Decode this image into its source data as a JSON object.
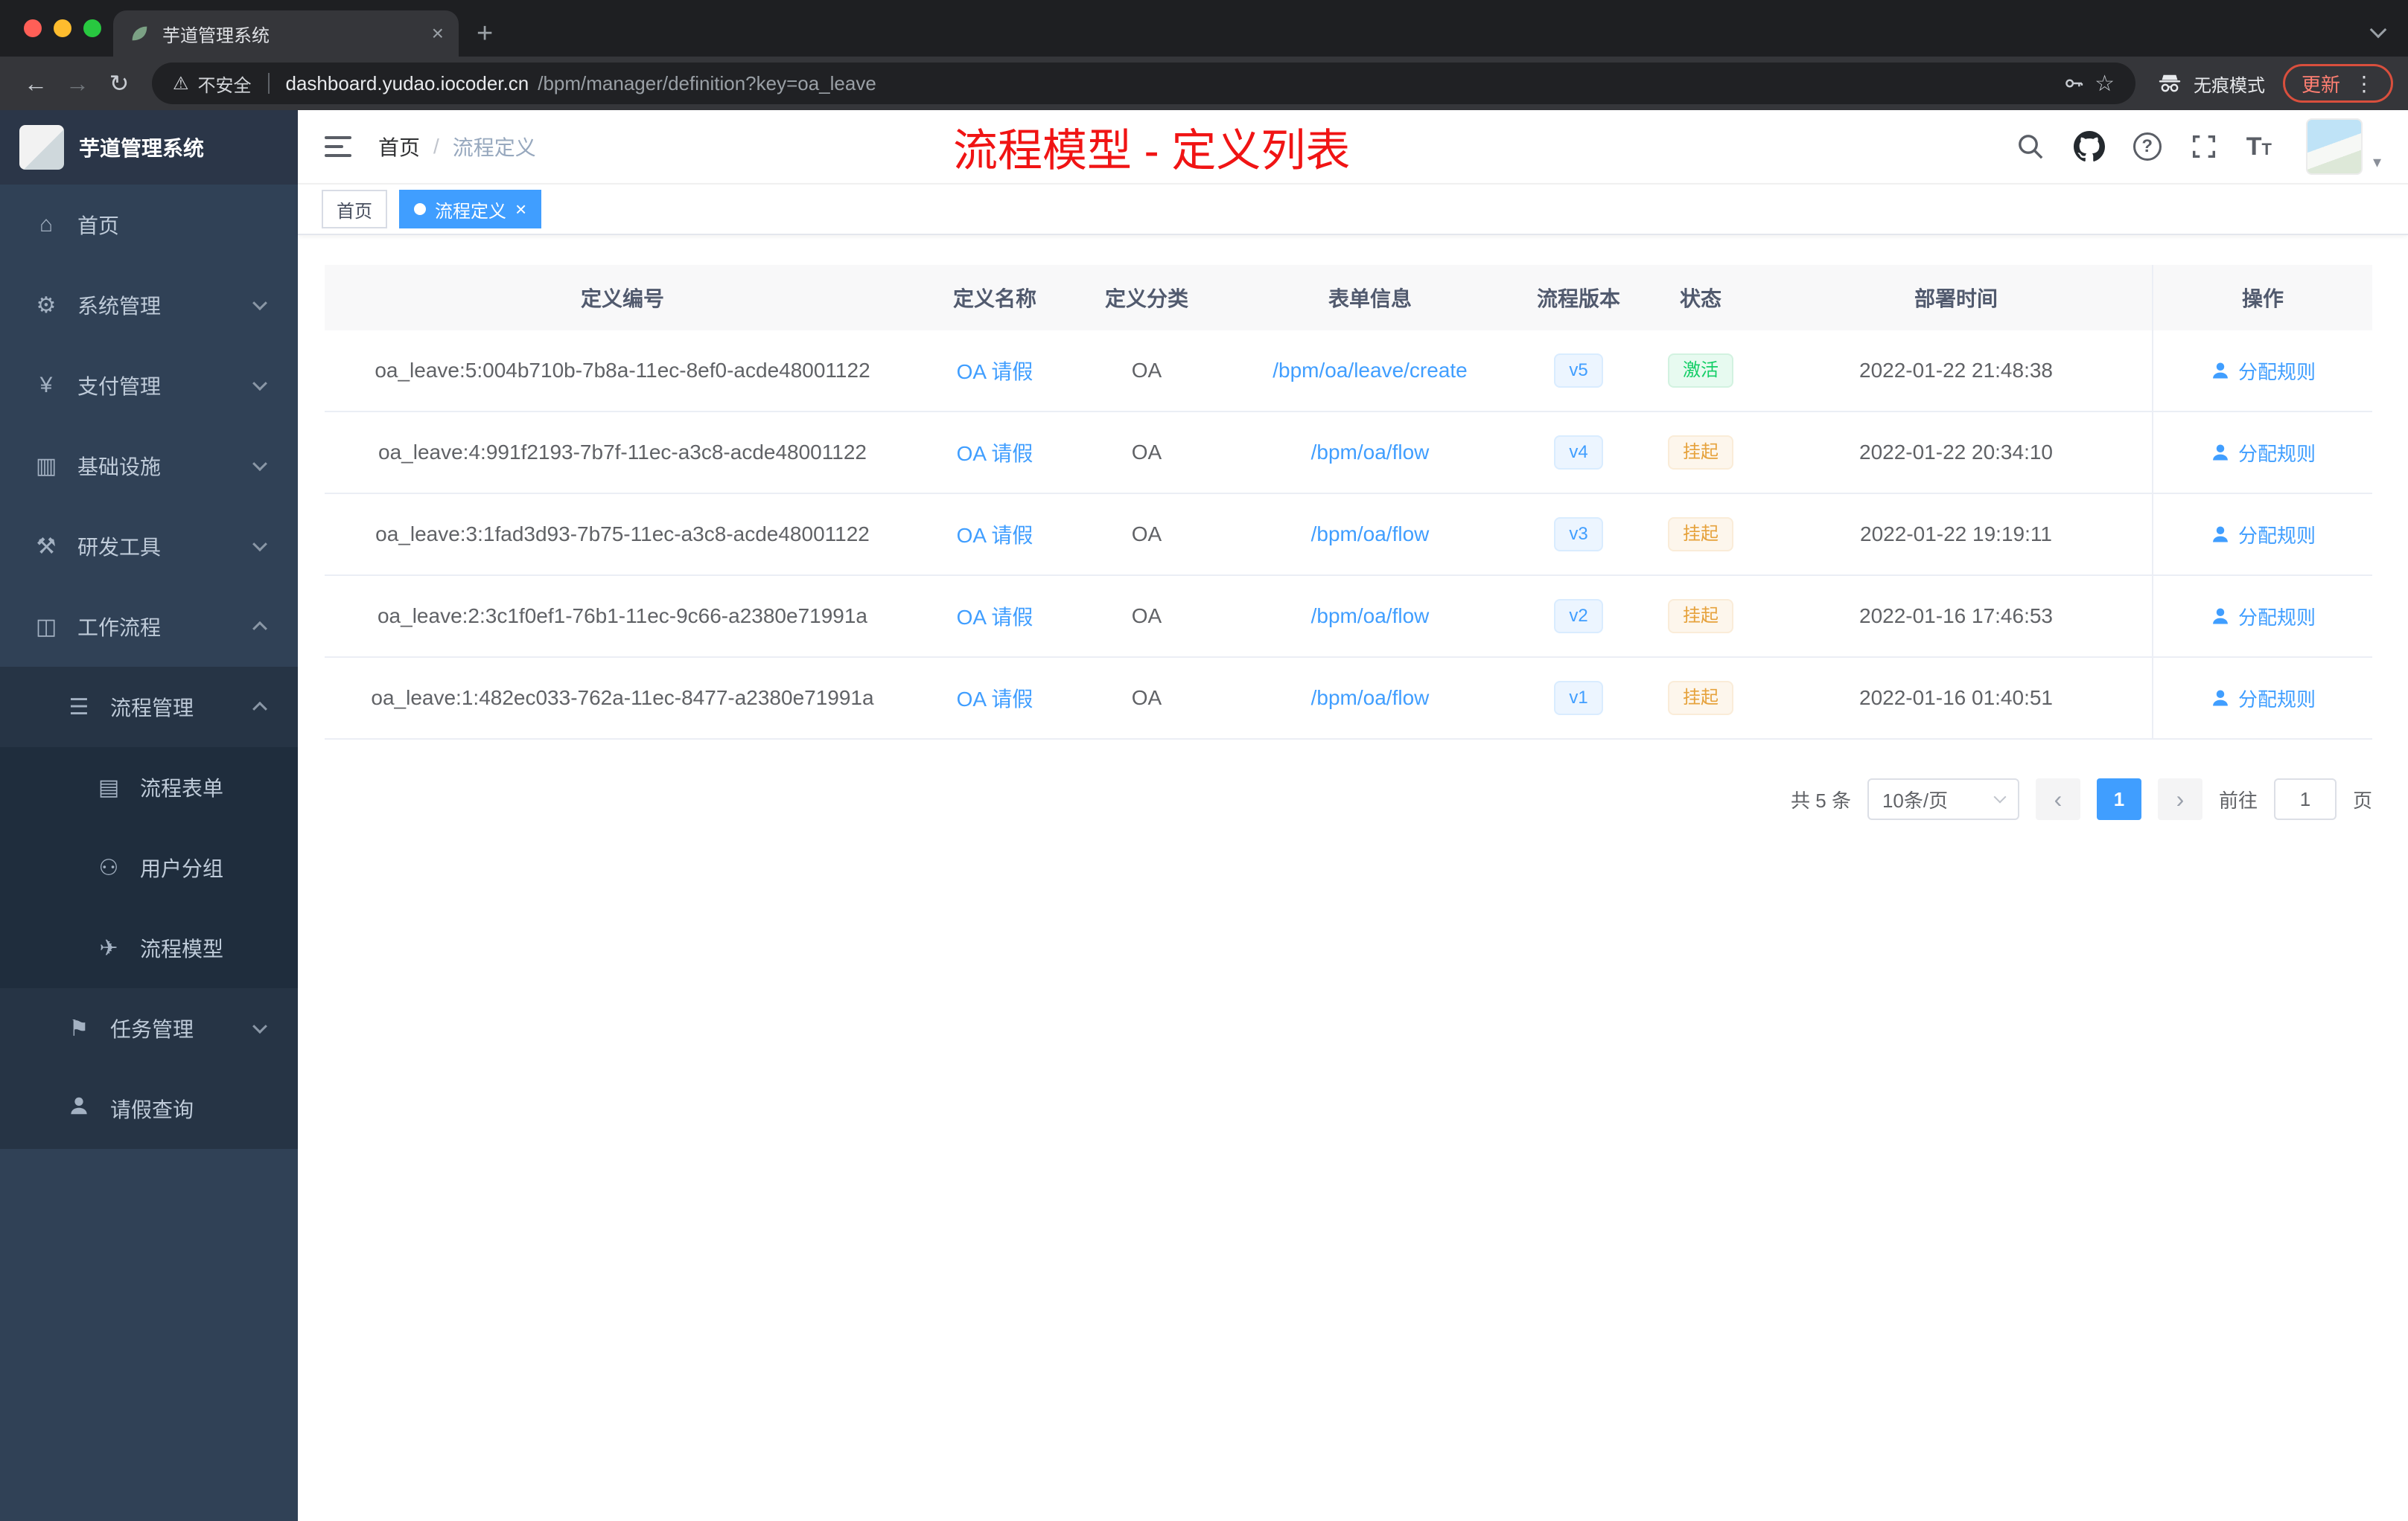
{
  "browser": {
    "tab_title": "芋道管理系统",
    "security_label": "不安全",
    "url_host": "dashboard.yudao.iocoder.cn",
    "url_path": "/bpm/manager/definition?key=oa_leave",
    "incognito_label": "无痕模式",
    "update_label": "更新"
  },
  "sidebar": {
    "logo_title": "芋道管理系统",
    "items": [
      {
        "label": "首页",
        "icon": "home-icon",
        "level": 1,
        "expandable": false,
        "expanded": false
      },
      {
        "label": "系统管理",
        "icon": "gear-icon",
        "level": 1,
        "expandable": true,
        "expanded": false
      },
      {
        "label": "支付管理",
        "icon": "payment-icon",
        "level": 1,
        "expandable": true,
        "expanded": false
      },
      {
        "label": "基础设施",
        "icon": "infrastructure-icon",
        "level": 1,
        "expandable": true,
        "expanded": false
      },
      {
        "label": "研发工具",
        "icon": "devtools-icon",
        "level": 1,
        "expandable": true,
        "expanded": false
      },
      {
        "label": "工作流程",
        "icon": "workflow-icon",
        "level": 1,
        "expandable": true,
        "expanded": true
      },
      {
        "label": "流程管理",
        "icon": "process-management-icon",
        "level": 2,
        "expandable": true,
        "expanded": true
      },
      {
        "label": "流程表单",
        "icon": "form-icon",
        "level": 3,
        "expandable": false,
        "expanded": false
      },
      {
        "label": "用户分组",
        "icon": "user-group-icon",
        "level": 3,
        "expandable": false,
        "expanded": false
      },
      {
        "label": "流程模型",
        "icon": "model-icon",
        "level": 3,
        "expandable": false,
        "expanded": false
      },
      {
        "label": "任务管理",
        "icon": "task-management-icon",
        "level": 2,
        "expandable": true,
        "expanded": false
      },
      {
        "label": "请假查询",
        "icon": "person-icon",
        "level": 2,
        "expandable": false,
        "expanded": false
      }
    ]
  },
  "header": {
    "breadcrumb_home": "首页",
    "breadcrumb_separator": "/",
    "breadcrumb_current": "流程定义",
    "annotation": "流程模型 - 定义列表"
  },
  "tags": {
    "home": "首页",
    "active_tag": "流程定义"
  },
  "table": {
    "columns": [
      "定义编号",
      "定义名称",
      "定义分类",
      "表单信息",
      "流程版本",
      "状态",
      "部署时间",
      "操作"
    ],
    "rows": [
      {
        "id": "oa_leave:5:004b710b-7b8a-11ec-8ef0-acde48001122",
        "name": "OA 请假",
        "category": "OA",
        "form": "/bpm/oa/leave/create",
        "version": "v5",
        "status": "激活",
        "status_type": "active",
        "deploy_time": "2022-01-22 21:48:38",
        "action": "分配规则"
      },
      {
        "id": "oa_leave:4:991f2193-7b7f-11ec-a3c8-acde48001122",
        "name": "OA 请假",
        "category": "OA",
        "form": "/bpm/oa/flow",
        "version": "v4",
        "status": "挂起",
        "status_type": "suspended",
        "deploy_time": "2022-01-22 20:34:10",
        "action": "分配规则"
      },
      {
        "id": "oa_leave:3:1fad3d93-7b75-11ec-a3c8-acde48001122",
        "name": "OA 请假",
        "category": "OA",
        "form": "/bpm/oa/flow",
        "version": "v3",
        "status": "挂起",
        "status_type": "suspended",
        "deploy_time": "2022-01-22 19:19:11",
        "action": "分配规则"
      },
      {
        "id": "oa_leave:2:3c1f0ef1-76b1-11ec-9c66-a2380e71991a",
        "name": "OA 请假",
        "category": "OA",
        "form": "/bpm/oa/flow",
        "version": "v2",
        "status": "挂起",
        "status_type": "suspended",
        "deploy_time": "2022-01-16 17:46:53",
        "action": "分配规则"
      },
      {
        "id": "oa_leave:1:482ec033-762a-11ec-8477-a2380e71991a",
        "name": "OA 请假",
        "category": "OA",
        "form": "/bpm/oa/flow",
        "version": "v1",
        "status": "挂起",
        "status_type": "suspended",
        "deploy_time": "2022-01-16 01:40:51",
        "action": "分配规则"
      }
    ]
  },
  "pagination": {
    "total": "共 5 条",
    "page_size": "10条/页",
    "current_page": "1",
    "goto_label": "前往",
    "goto_value": "1",
    "page_unit": "页"
  }
}
